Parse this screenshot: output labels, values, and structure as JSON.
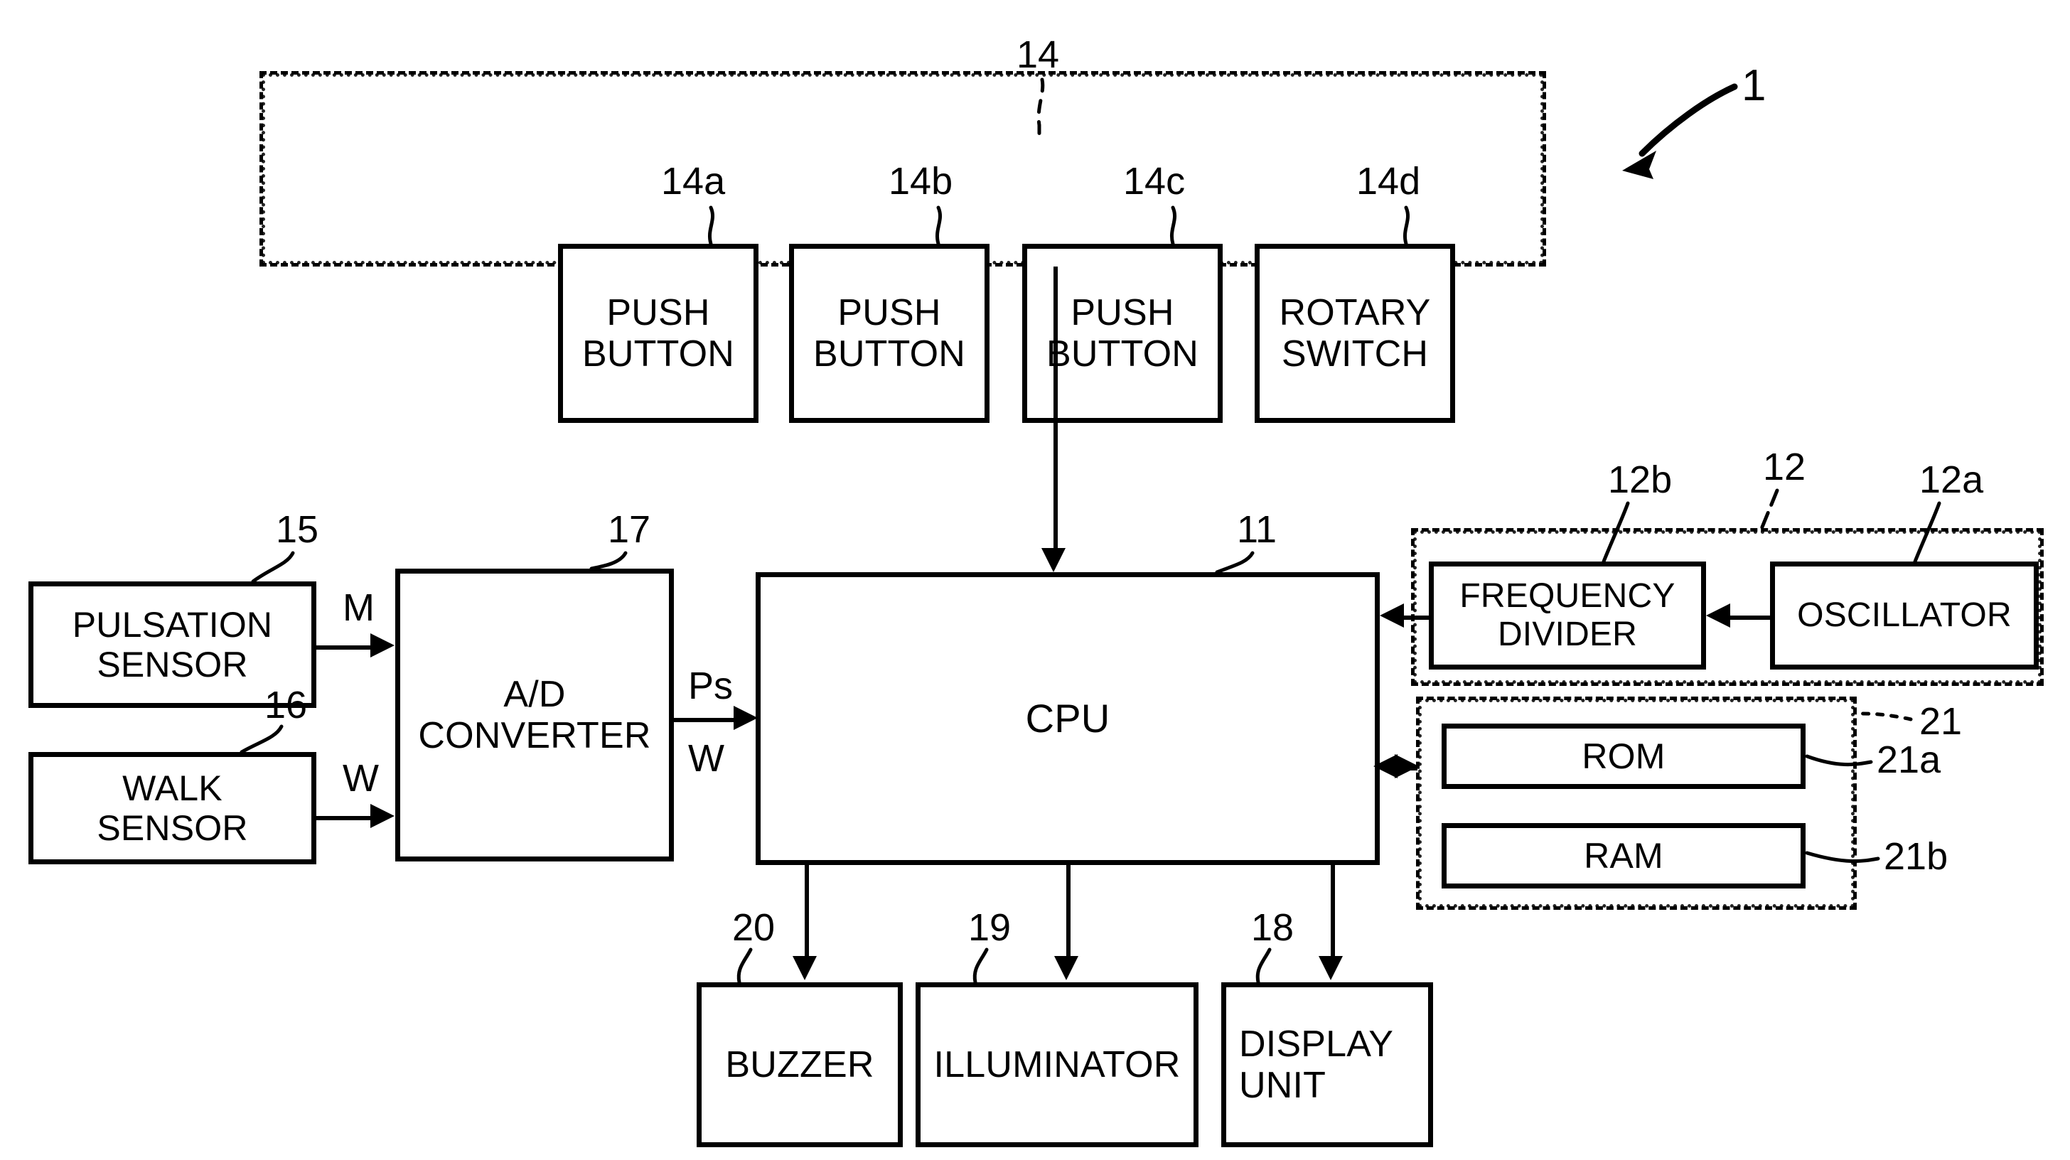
{
  "figure": {
    "title": "Electronic pulsation-measuring wristwatch block diagram",
    "system_ref": "1"
  },
  "input_group": {
    "ref": "14",
    "items": [
      {
        "ref": "14a",
        "label": "PUSH\nBUTTON"
      },
      {
        "ref": "14b",
        "label": "PUSH\nBUTTON"
      },
      {
        "ref": "14c",
        "label": "PUSH\nBUTTON"
      },
      {
        "ref": "14d",
        "label": "ROTARY\nSWITCH"
      }
    ]
  },
  "sensors": [
    {
      "ref": "15",
      "label": "PULSATION\nSENSOR",
      "signal": "M"
    },
    {
      "ref": "16",
      "label": "WALK\nSENSOR",
      "signal": "W"
    }
  ],
  "converter": {
    "ref": "17",
    "label": "A/D\nCONVERTER",
    "out_signal_top": "Ps",
    "out_signal_bottom": "W"
  },
  "cpu": {
    "ref": "11",
    "label": "CPU"
  },
  "clock_group": {
    "ref": "12",
    "items": [
      {
        "ref": "12b",
        "label": "FREQUENCY\nDIVIDER"
      },
      {
        "ref": "12a",
        "label": "OSCILLATOR"
      }
    ]
  },
  "memory_group": {
    "ref": "21",
    "items": [
      {
        "ref": "21a",
        "label": "ROM"
      },
      {
        "ref": "21b",
        "label": "RAM"
      }
    ]
  },
  "outputs": [
    {
      "ref": "20",
      "label": "BUZZER"
    },
    {
      "ref": "19",
      "label": "ILLUMINATOR"
    },
    {
      "ref": "18",
      "label": "DISPLAY\nUNIT"
    }
  ],
  "colors": {
    "ink": "#000000",
    "paper": "#ffffff"
  }
}
